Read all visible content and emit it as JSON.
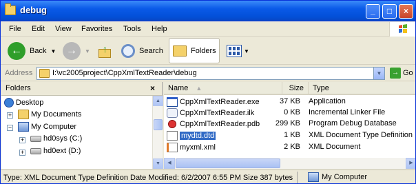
{
  "window": {
    "title": "debug",
    "minimize": "_",
    "maximize": "□",
    "close": "×"
  },
  "menu": [
    "File",
    "Edit",
    "View",
    "Favorites",
    "Tools",
    "Help"
  ],
  "toolbar": {
    "back": "Back",
    "search": "Search",
    "folders": "Folders"
  },
  "address": {
    "label": "Address",
    "value": "I:\\vc2005project\\CppXmlTextReader\\debug",
    "go": "Go"
  },
  "folders_pane": {
    "title": "Folders",
    "close": "×",
    "items": [
      {
        "label": "Desktop",
        "icon": "desktop-icon"
      },
      {
        "label": "My Documents",
        "icon": "folder-icon",
        "expander": "+"
      },
      {
        "label": "My Computer",
        "icon": "computer-icon",
        "expander": "−"
      },
      {
        "label": "hd0sys (C:)",
        "icon": "drive-icon",
        "expander": "+"
      },
      {
        "label": "hd0ext (D:)",
        "icon": "drive-icon",
        "expander": "+"
      }
    ]
  },
  "files": {
    "headers": {
      "name": "Name",
      "size": "Size",
      "type": "Type"
    },
    "rows": [
      {
        "name": "CppXmlTextReader.exe",
        "size": "37 KB",
        "type": "Application",
        "icon": "exe-icon"
      },
      {
        "name": "CppXmlTextReader.ilk",
        "size": "0 KB",
        "type": "Incremental Linker File",
        "icon": "ilk-icon"
      },
      {
        "name": "CppXmlTextReader.pdb",
        "size": "299 KB",
        "type": "Program Debug Database",
        "icon": "pdb-icon"
      },
      {
        "name": "mydtd.dtd",
        "size": "1 KB",
        "type": "XML Document Type Definition",
        "icon": "dtd-icon",
        "selected": true
      },
      {
        "name": "myxml.xml",
        "size": "2 KB",
        "type": "XML Document",
        "icon": "xml-icon"
      }
    ]
  },
  "status": {
    "text": "Type: XML Document Type Definition Date Modified: 6/2/2007 6:55 PM Size 387 bytes",
    "zone": "My Computer"
  },
  "colors": {
    "titlebar": "#0a5ae8",
    "selection": "#316ac5",
    "chrome": "#ece9d8"
  }
}
